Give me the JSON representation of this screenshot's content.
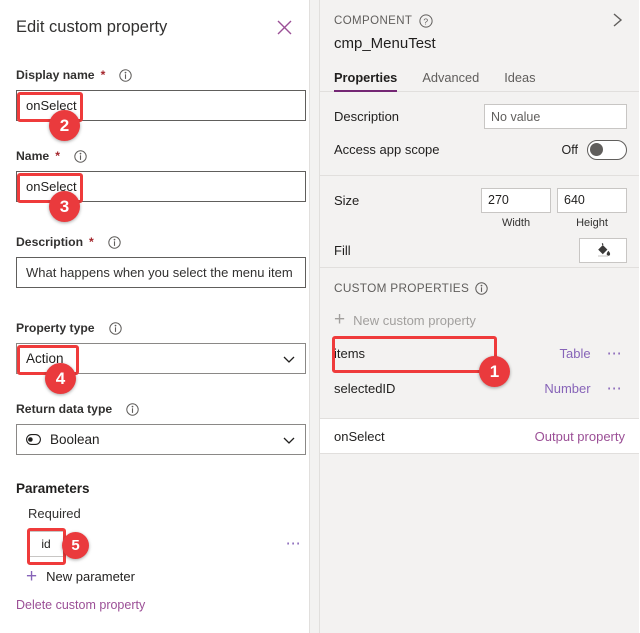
{
  "left_panel": {
    "title": "Edit custom property",
    "close_icon": "close-icon",
    "fields": {
      "display_name": {
        "label": "Display name",
        "required_mark": "*",
        "info_icon": "info-icon",
        "value": "onSelect"
      },
      "name": {
        "label": "Name",
        "required_mark": "*",
        "info_icon": "info-icon",
        "value": "onSelect"
      },
      "description": {
        "label": "Description",
        "required_mark": "*",
        "info_icon": "info-icon",
        "value": "What happens when you select the menu item"
      },
      "property_type": {
        "label": "Property type",
        "info_icon": "info-icon",
        "value": "Action",
        "chevron_icon": "chevron-down-icon"
      },
      "return_data_type": {
        "label": "Return data type",
        "info_icon": "info-icon",
        "value": "Boolean",
        "value_icon": "boolean-toggle-icon",
        "chevron_icon": "chevron-down-icon"
      }
    },
    "parameters": {
      "heading": "Parameters",
      "required_label": "Required",
      "items": [
        {
          "name": "id",
          "overflow_icon": "ellipsis-icon"
        }
      ],
      "new_parameter_label": "New parameter",
      "new_parameter_icon": "plus-icon"
    },
    "delete_link": "Delete custom property"
  },
  "right_panel": {
    "kicker": "COMPONENT",
    "kicker_icon": "help-circle-icon",
    "collapse_icon": "chevron-right-icon",
    "component_name": "cmp_MenuTest",
    "tabs": [
      {
        "label": "Properties",
        "active": true
      },
      {
        "label": "Advanced",
        "active": false
      },
      {
        "label": "Ideas",
        "active": false
      }
    ],
    "properties": {
      "description": {
        "label": "Description",
        "value": "No value"
      },
      "access_app_scope": {
        "label": "Access app scope",
        "state": "Off"
      },
      "size": {
        "label": "Size",
        "width_value": "270",
        "height_value": "640",
        "width_caption": "Width",
        "height_caption": "Height"
      },
      "fill": {
        "label": "Fill",
        "icon": "paint-bucket-icon"
      }
    },
    "custom_properties": {
      "heading": "CUSTOM PROPERTIES",
      "heading_icon": "info-icon",
      "new_label": "New custom property",
      "new_icon": "plus-icon",
      "rows": [
        {
          "name": "items",
          "type": "Table",
          "overflow_icon": "ellipsis-icon"
        },
        {
          "name": "selectedID",
          "type": "Number",
          "overflow_icon": "ellipsis-icon"
        }
      ],
      "output_row": {
        "name": "onSelect",
        "type": "Output property"
      }
    }
  },
  "annotations": {
    "accent_color": "#ea3a3d",
    "badges": [
      {
        "number": "1"
      },
      {
        "number": "2"
      },
      {
        "number": "3"
      },
      {
        "number": "4"
      },
      {
        "number": "5"
      }
    ]
  }
}
